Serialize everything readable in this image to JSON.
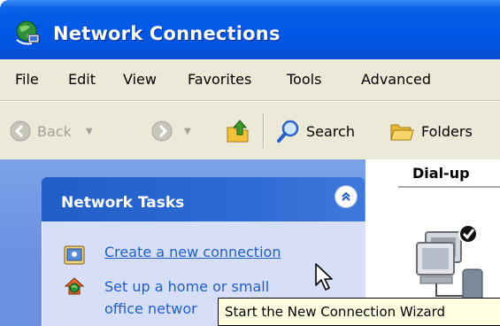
{
  "window": {
    "title": "Network Connections",
    "icon": "network-connections-icon"
  },
  "menu": {
    "items": [
      "File",
      "Edit",
      "View",
      "Favorites",
      "Tools",
      "Advanced"
    ]
  },
  "toolbar": {
    "back_label": "Back",
    "search_label": "Search",
    "folders_label": "Folders"
  },
  "task_pane": {
    "header": "Network Tasks",
    "links": [
      {
        "label": "Create a new connection",
        "icon": "new-connection-icon"
      },
      {
        "label_line1": "Set up a home or small",
        "label_line2": "office networ",
        "icon": "home-network-icon"
      }
    ]
  },
  "content": {
    "column_header": "Dial-up"
  },
  "tooltip": {
    "text": "Start the New Connection Wizard"
  },
  "colors": {
    "titlebar": "#0054dd",
    "taskpane_bg": "#6b8fe3",
    "task_header": "#215dc6",
    "task_body": "#d6dff7",
    "link": "#215dc6",
    "tooltip_bg": "#ffffe1"
  }
}
